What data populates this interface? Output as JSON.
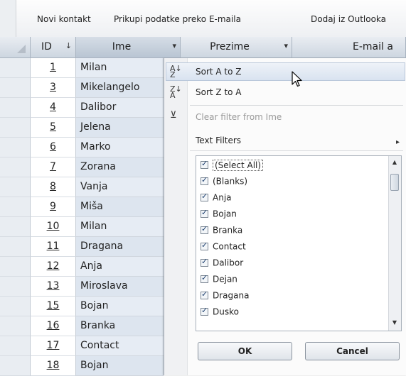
{
  "toolbar": {
    "new_contact": "Novi kontakt",
    "collect_email": "Prikupi podatke preko E-maila",
    "add_outlook": "Dodaj iz Outlooka"
  },
  "columns": {
    "id": "ID",
    "ime": "Ime",
    "prezime": "Prezime",
    "email": "E-mail a"
  },
  "rows": [
    {
      "id": "1",
      "ime": "Milan"
    },
    {
      "id": "3",
      "ime": "Mikelangelo"
    },
    {
      "id": "4",
      "ime": "Dalibor"
    },
    {
      "id": "5",
      "ime": "Jelena"
    },
    {
      "id": "6",
      "ime": "Marko"
    },
    {
      "id": "7",
      "ime": "Zorana"
    },
    {
      "id": "8",
      "ime": "Vanja"
    },
    {
      "id": "9",
      "ime": "Miša"
    },
    {
      "id": "10",
      "ime": "Milan"
    },
    {
      "id": "11",
      "ime": "Dragana"
    },
    {
      "id": "12",
      "ime": "Anja"
    },
    {
      "id": "13",
      "ime": "Miroslava"
    },
    {
      "id": "15",
      "ime": "Bojan"
    },
    {
      "id": "16",
      "ime": "Branka"
    },
    {
      "id": "17",
      "ime": "Contact"
    },
    {
      "id": "18",
      "ime": "Bojan"
    }
  ],
  "menu": {
    "sort_az": "Sort A to Z",
    "sort_za": "Sort Z to A",
    "clear_filter": "Clear filter from Ime",
    "text_filters": "Text Filters",
    "ok": "OK",
    "cancel": "Cancel"
  },
  "filter_values": [
    "(Select All)",
    "(Blanks)",
    "Anja",
    "Bojan",
    "Branka",
    "Contact",
    "Dalibor",
    "Dejan",
    "Dragana",
    "Dusko"
  ]
}
